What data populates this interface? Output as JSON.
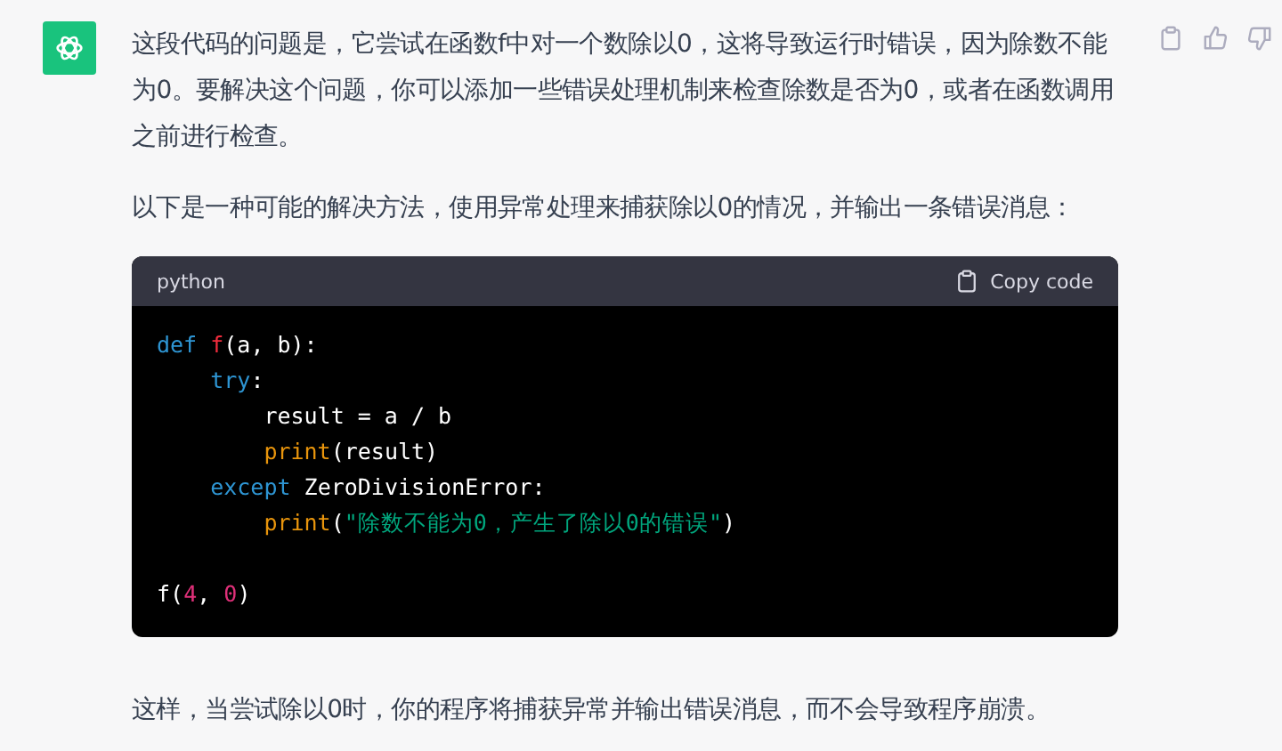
{
  "message": {
    "paragraphs_before": [
      "这段代码的问题是，它尝试在函数f中对一个数除以0，这将导致运行时错误，因为除数不能为0。要解决这个问题，你可以添加一些错误处理机制来检查除数是否为0，或者在函数调用之前进行检查。",
      "以下是一种可能的解决方法，使用异常处理来捕获除以0的情况，并输出一条错误消息："
    ],
    "code_block": {
      "language": "python",
      "copy_label": "Copy code",
      "lines": [
        {
          "kind": "code",
          "tokens": [
            {
              "kind": "keyword",
              "text": "def "
            },
            {
              "kind": "function",
              "text": "f"
            },
            {
              "kind": "plain",
              "text": "(a, b):"
            }
          ]
        },
        {
          "kind": "code",
          "tokens": [
            {
              "kind": "keyword",
              "text": "    try"
            },
            {
              "kind": "plain",
              "text": ":"
            }
          ]
        },
        {
          "kind": "code",
          "tokens": [
            {
              "kind": "plain",
              "text": "        result = a / b"
            }
          ]
        },
        {
          "kind": "code",
          "tokens": [
            {
              "kind": "builtin",
              "text": "        print"
            },
            {
              "kind": "plain",
              "text": "(result)"
            }
          ]
        },
        {
          "kind": "code",
          "tokens": [
            {
              "kind": "keyword",
              "text": "    except"
            },
            {
              "kind": "plain",
              "text": " ZeroDivisionError:"
            }
          ]
        },
        {
          "kind": "code",
          "tokens": [
            {
              "kind": "builtin",
              "text": "        print"
            },
            {
              "kind": "plain",
              "text": "("
            },
            {
              "kind": "string",
              "text": "\"除数不能为0，产生了除以0的错误\""
            },
            {
              "kind": "plain",
              "text": ")"
            }
          ]
        },
        {
          "kind": "blank"
        },
        {
          "kind": "code",
          "tokens": [
            {
              "kind": "plain",
              "text": "f("
            },
            {
              "kind": "number",
              "text": "4"
            },
            {
              "kind": "plain",
              "text": ", "
            },
            {
              "kind": "number",
              "text": "0"
            },
            {
              "kind": "plain",
              "text": ")"
            }
          ]
        }
      ]
    },
    "paragraphs_after": [
      "这样，当尝试除以0时，你的程序将捕获异常并输出错误消息，而不会导致程序崩溃。"
    ]
  }
}
